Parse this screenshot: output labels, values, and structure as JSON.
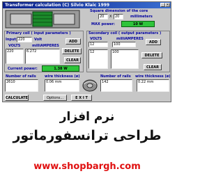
{
  "window": {
    "title": "Transformer calculation (C) Silvio Klaic 1999"
  },
  "core": {
    "heading": "Square dimension of the core",
    "dim_a": "20",
    "times": "X",
    "dim_b": "20",
    "unit": "millimeters",
    "max_power_label": "MAX power:",
    "max_power_value": "10 W"
  },
  "primary": {
    "heading": "Primary coil ( input parameters )",
    "input_label": "Input:",
    "input_value": "220",
    "volt_label": "Volt",
    "col_volts": "VOLTS",
    "col_milliamperes": "milliAMPERES",
    "volts_value": "220",
    "ma_value": "6.272",
    "add": "ADD",
    "delete": "DELETE",
    "clear": "CLEAR",
    "current_power_label": "Current power:",
    "current_power_value": "1.38 W"
  },
  "secondary": {
    "heading": "Secondary coil ( output parameters )",
    "col_volts": "VOLTS",
    "col_milliamperes": "milliAMPERES",
    "volts_value": "12",
    "ma_value": "100",
    "row_volts": "12",
    "row_ma": "100",
    "add": "ADD",
    "delete": "DELETE",
    "clear": "CLEAR"
  },
  "results": {
    "primary_rails_label": "Number of rails",
    "primary_wire_label": "wire thickness (ø)",
    "primary_rails": "2610",
    "primary_wire": "0.06 mm",
    "secondary_rails_label": "Number of rails",
    "secondary_wire_label": "wire thickness (ø)",
    "secondary_rails": "142",
    "secondary_wire": "0.22 mm"
  },
  "buttons": {
    "calculate": "CALCULATE",
    "options": "Options...",
    "exit": "E X I T"
  },
  "caption": {
    "line1": "نرم افزار",
    "line2": "طراحی ترانسفورماتور",
    "url": "www.shopbargh.com"
  }
}
